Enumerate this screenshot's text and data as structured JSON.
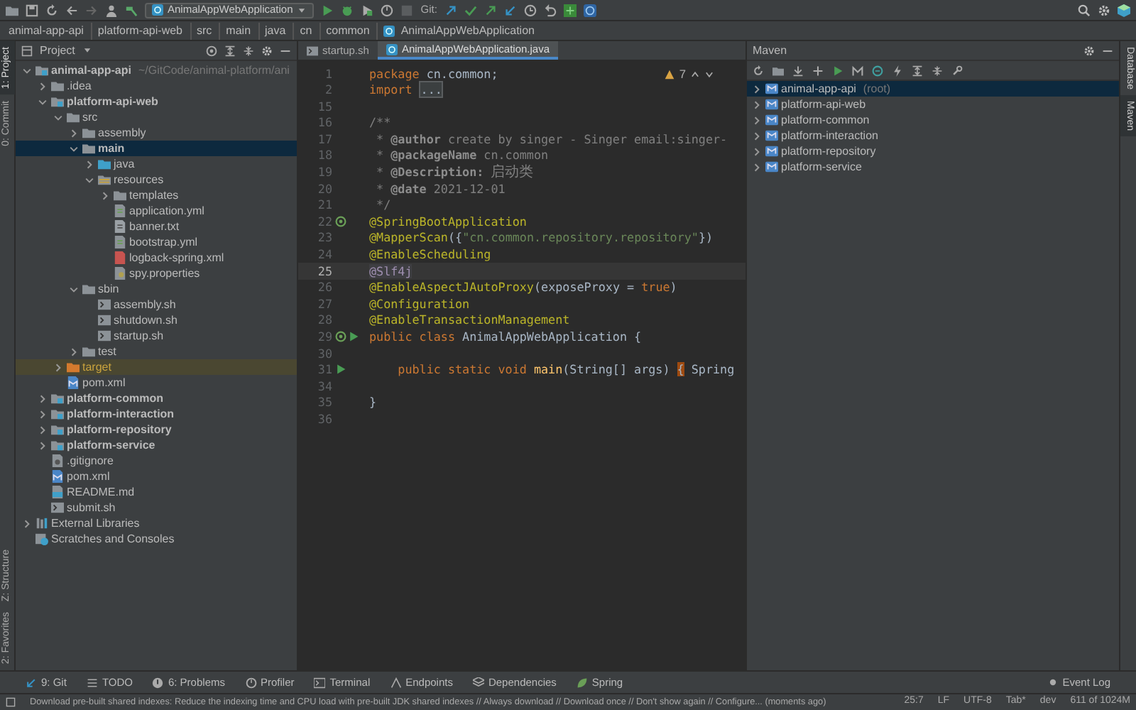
{
  "toolbar": {
    "run_config": "AnimalAppWebApplication",
    "vcs_label": "Git:"
  },
  "breadcrumbs": [
    "animal-app-api",
    "platform-api-web",
    "src",
    "main",
    "java",
    "cn",
    "common",
    "AnimalAppWebApplication"
  ],
  "left_strip": {
    "top": [
      {
        "label": "1: Project",
        "selected": true
      },
      {
        "label": "0: Commit",
        "selected": false
      }
    ],
    "bottom": [
      {
        "label": "Z: Structure",
        "selected": false
      },
      {
        "label": "2: Favorites",
        "selected": false
      }
    ]
  },
  "project_panel": {
    "title": "Project",
    "tree": [
      {
        "label": "animal-app-api",
        "hint": "~/GitCode/animal-platform/ani",
        "kind": "module",
        "expanded": true,
        "selected": false,
        "children": [
          {
            "label": ".idea",
            "kind": "idea-folder",
            "expanded": false,
            "selected": false
          },
          {
            "label": "platform-api-web",
            "kind": "module",
            "expanded": true,
            "selected": false,
            "children": [
              {
                "label": "src",
                "kind": "folder",
                "expanded": true,
                "selected": false,
                "children": [
                  {
                    "label": "assembly",
                    "kind": "folder",
                    "expanded": false,
                    "selected": false
                  },
                  {
                    "label": "main",
                    "kind": "folder",
                    "expanded": true,
                    "selected": true,
                    "children": [
                      {
                        "label": "java",
                        "kind": "source-folder",
                        "expanded": false,
                        "selected": false
                      },
                      {
                        "label": "resources",
                        "kind": "resources-folder",
                        "expanded": true,
                        "selected": false,
                        "children": [
                          {
                            "label": "templates",
                            "kind": "folder",
                            "expanded": false,
                            "selected": false
                          },
                          {
                            "label": "application.yml",
                            "kind": "yaml",
                            "selected": false
                          },
                          {
                            "label": "banner.txt",
                            "kind": "text",
                            "selected": false
                          },
                          {
                            "label": "bootstrap.yml",
                            "kind": "yaml",
                            "selected": false
                          },
                          {
                            "label": "logback-spring.xml",
                            "kind": "xml",
                            "selected": false
                          },
                          {
                            "label": "spy.properties",
                            "kind": "properties",
                            "selected": false
                          }
                        ]
                      }
                    ]
                  },
                  {
                    "label": "sbin",
                    "kind": "folder",
                    "expanded": true,
                    "selected": false,
                    "children": [
                      {
                        "label": "assembly.sh",
                        "kind": "shell",
                        "selected": false
                      },
                      {
                        "label": "shutdown.sh",
                        "kind": "shell",
                        "selected": false
                      },
                      {
                        "label": "startup.sh",
                        "kind": "shell",
                        "selected": false
                      }
                    ]
                  },
                  {
                    "label": "test",
                    "kind": "folder",
                    "expanded": false,
                    "selected": false
                  }
                ]
              },
              {
                "label": "target",
                "kind": "excluded-folder",
                "expanded": false,
                "selected": false
              },
              {
                "label": "pom.xml",
                "kind": "maven",
                "selected": false
              }
            ]
          },
          {
            "label": "platform-common",
            "kind": "module",
            "expanded": false,
            "selected": false
          },
          {
            "label": "platform-interaction",
            "kind": "module",
            "expanded": false,
            "selected": false
          },
          {
            "label": "platform-repository",
            "kind": "module",
            "expanded": false,
            "selected": false
          },
          {
            "label": "platform-service",
            "kind": "module",
            "expanded": false,
            "selected": false
          },
          {
            "label": ".gitignore",
            "kind": "gitignore",
            "selected": false
          },
          {
            "label": "pom.xml",
            "kind": "maven",
            "selected": false
          },
          {
            "label": "README.md",
            "kind": "markdown",
            "selected": false
          },
          {
            "label": "submit.sh",
            "kind": "shell",
            "selected": false
          }
        ]
      },
      {
        "label": "External Libraries",
        "kind": "libraries",
        "expanded": false,
        "selected": false
      },
      {
        "label": "Scratches and Consoles",
        "kind": "scratches",
        "selected": false
      }
    ]
  },
  "editor": {
    "tabs": [
      {
        "label": "startup.sh",
        "selected": false
      },
      {
        "label": "AnimalAppWebApplication.java",
        "selected": true
      }
    ],
    "warnings": "7",
    "lines": [
      {
        "number": "1",
        "current": false,
        "tokens": [
          {
            "kind": "keyword",
            "text": "package"
          },
          {
            "kind": "plain",
            "text": "cn.common;"
          }
        ]
      },
      {
        "number": "2",
        "current": false,
        "tokens": [
          {
            "kind": "keyword",
            "text": "import"
          },
          {
            "kind": "fold",
            "text": "..."
          }
        ]
      },
      {
        "number": "15",
        "current": false
      },
      {
        "number": "16",
        "current": false,
        "tokens": [
          {
            "kind": "comment",
            "text": "/**"
          }
        ]
      },
      {
        "number": "17",
        "current": false,
        "tokens": [
          {
            "kind": "comment",
            "text": " *"
          },
          {
            "kind": "doctag",
            "text": "@author"
          },
          {
            "kind": "comment",
            "text": "create by singer - Singer email:singer-"
          }
        ]
      },
      {
        "number": "18",
        "current": false,
        "tokens": [
          {
            "kind": "comment",
            "text": " *"
          },
          {
            "kind": "doctag",
            "text": "@packageName"
          },
          {
            "kind": "comment",
            "text": "cn.common"
          }
        ]
      },
      {
        "number": "19",
        "current": false,
        "tokens": [
          {
            "kind": "comment",
            "text": " *"
          },
          {
            "kind": "doctag",
            "text": "@Description:"
          },
          {
            "kind": "comment",
            "text": "启动类"
          }
        ]
      },
      {
        "number": "20",
        "current": false,
        "tokens": [
          {
            "kind": "comment",
            "text": " *"
          },
          {
            "kind": "doctag",
            "text": "@date"
          },
          {
            "kind": "comment",
            "text": "2021-12-01"
          }
        ]
      },
      {
        "number": "21",
        "current": false,
        "tokens": [
          {
            "kind": "comment",
            "text": " */"
          }
        ]
      },
      {
        "number": "22",
        "current": false,
        "bean": true,
        "tokens": [
          {
            "kind": "annotation",
            "text": "@SpringBootApplication"
          }
        ]
      },
      {
        "number": "23",
        "current": false,
        "tokens": [
          {
            "kind": "annotation",
            "text": "@MapperScan"
          },
          {
            "kind": "plain",
            "text": "({"
          },
          {
            "kind": "string",
            "text": "\"cn.common.repository.repository\""
          },
          {
            "kind": "plain",
            "text": "})"
          }
        ]
      },
      {
        "number": "24",
        "current": false,
        "tokens": [
          {
            "kind": "annotation",
            "text": "@EnableScheduling"
          }
        ]
      },
      {
        "number": "25",
        "current": true,
        "tokens": [
          {
            "kind": "unused",
            "text": "@Slf4j"
          }
        ]
      },
      {
        "number": "26",
        "current": false,
        "tokens": [
          {
            "kind": "annotation",
            "text": "@EnableAspectJAutoProxy"
          },
          {
            "kind": "plain",
            "text": "(exposeProxy ="
          },
          {
            "kind": "keyword",
            "text": "true"
          },
          {
            "kind": "plain",
            "text": ")"
          }
        ]
      },
      {
        "number": "27",
        "current": false,
        "tokens": [
          {
            "kind": "annotation",
            "text": "@Configuration"
          }
        ]
      },
      {
        "number": "28",
        "current": false,
        "tokens": [
          {
            "kind": "annotation",
            "text": "@EnableTransactionManagement"
          }
        ]
      },
      {
        "number": "29",
        "current": false,
        "bean": true,
        "run": true,
        "tokens": [
          {
            "kind": "keyword",
            "text": "public class"
          },
          {
            "kind": "plain",
            "text": "AnimalAppWebApplication {"
          }
        ]
      },
      {
        "number": "30",
        "current": false
      },
      {
        "number": "31",
        "current": false,
        "indented": true,
        "run": true,
        "tokens": [
          {
            "kind": "keyword",
            "text": "public static void"
          },
          {
            "kind": "method",
            "text": "main"
          },
          {
            "kind": "plain",
            "text": "(String[] args)"
          },
          {
            "kind": "brace",
            "text": "{"
          },
          {
            "kind": "plain",
            "text": "Spring"
          }
        ]
      },
      {
        "number": "34",
        "current": false
      },
      {
        "number": "35",
        "current": false,
        "tokens": [
          {
            "kind": "plain",
            "text": "}"
          }
        ]
      },
      {
        "number": "36",
        "current": false
      }
    ]
  },
  "maven": {
    "title": "Maven",
    "items": [
      {
        "label": "animal-app-api",
        "suffix": "(root)",
        "expanded": false,
        "selected": true
      },
      {
        "label": "platform-api-web",
        "expanded": false,
        "selected": false
      },
      {
        "label": "platform-common",
        "expanded": false,
        "selected": false
      },
      {
        "label": "platform-interaction",
        "expanded": false,
        "selected": false
      },
      {
        "label": "platform-repository",
        "expanded": false,
        "selected": false
      },
      {
        "label": "platform-service",
        "expanded": false,
        "selected": false
      }
    ]
  },
  "right_strip": [
    {
      "label": "Database",
      "selected": false
    },
    {
      "label": "Maven",
      "selected": true
    }
  ],
  "tool_windows": [
    {
      "label": "9: Git",
      "kind": "git"
    },
    {
      "label": "TODO",
      "kind": "list"
    },
    {
      "label": "6: Problems",
      "kind": "problems"
    },
    {
      "label": "Profiler",
      "kind": "profiler"
    },
    {
      "label": "Terminal",
      "kind": "terminal"
    },
    {
      "label": "Endpoints",
      "kind": "endpoints"
    },
    {
      "label": "Dependencies",
      "kind": "dependencies"
    },
    {
      "label": "Spring",
      "kind": "spring"
    }
  ],
  "event_log": "Event Log",
  "status_bar": {
    "message": "Download pre-built shared indexes: Reduce the indexing time and CPU load with pre-built JDK shared indexes // Always download // Download once // Don't show again // Configure... (moments ago)",
    "items": [
      "25:7",
      "LF",
      "UTF-8",
      "Tab*",
      "dev",
      "611 of 1024M"
    ]
  }
}
